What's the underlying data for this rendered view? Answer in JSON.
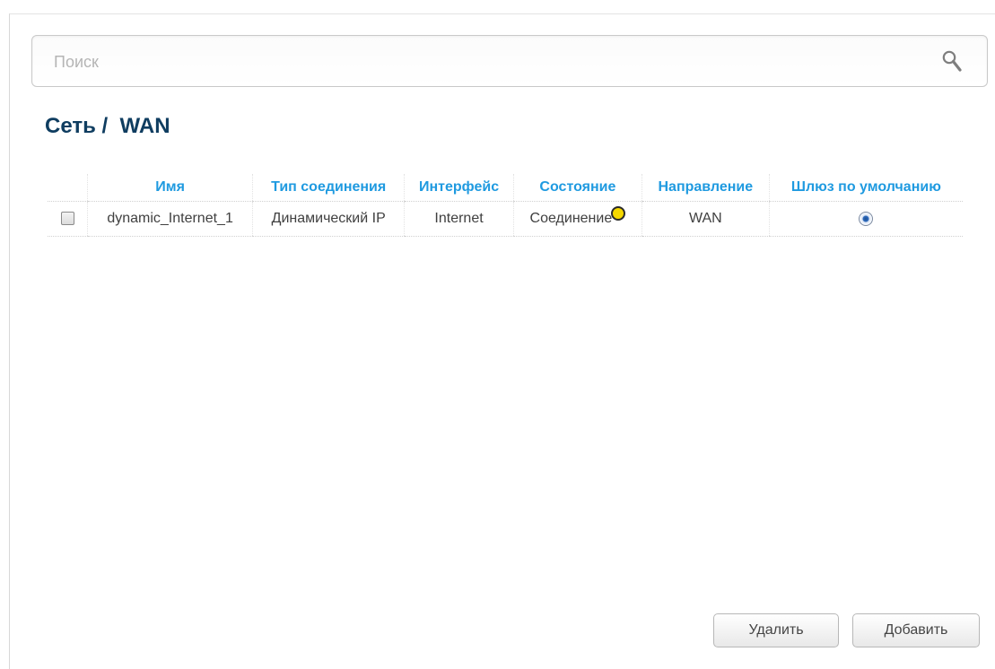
{
  "search": {
    "placeholder": "Поиск",
    "value": ""
  },
  "page": {
    "title": "Сеть /  WAN"
  },
  "table": {
    "headers": [
      "Имя",
      "Тип соединения",
      "Интерфейс",
      "Состояние",
      "Направление",
      "Шлюз по умолчанию"
    ],
    "rows": [
      {
        "checked": false,
        "name": "dynamic_Internet_1",
        "connection_type": "Динамический IP",
        "interface": "Internet",
        "status": "Соединение",
        "status_color": "#f5d800",
        "direction": "WAN",
        "default_gateway": true
      }
    ]
  },
  "buttons": {
    "delete_label": "Удалить",
    "add_label": "Добавить"
  },
  "colors": {
    "title": "#0f3d60",
    "header_text": "#1f9ae0"
  },
  "icons": {
    "search": "search-icon",
    "status": "status-indicator-icon"
  }
}
